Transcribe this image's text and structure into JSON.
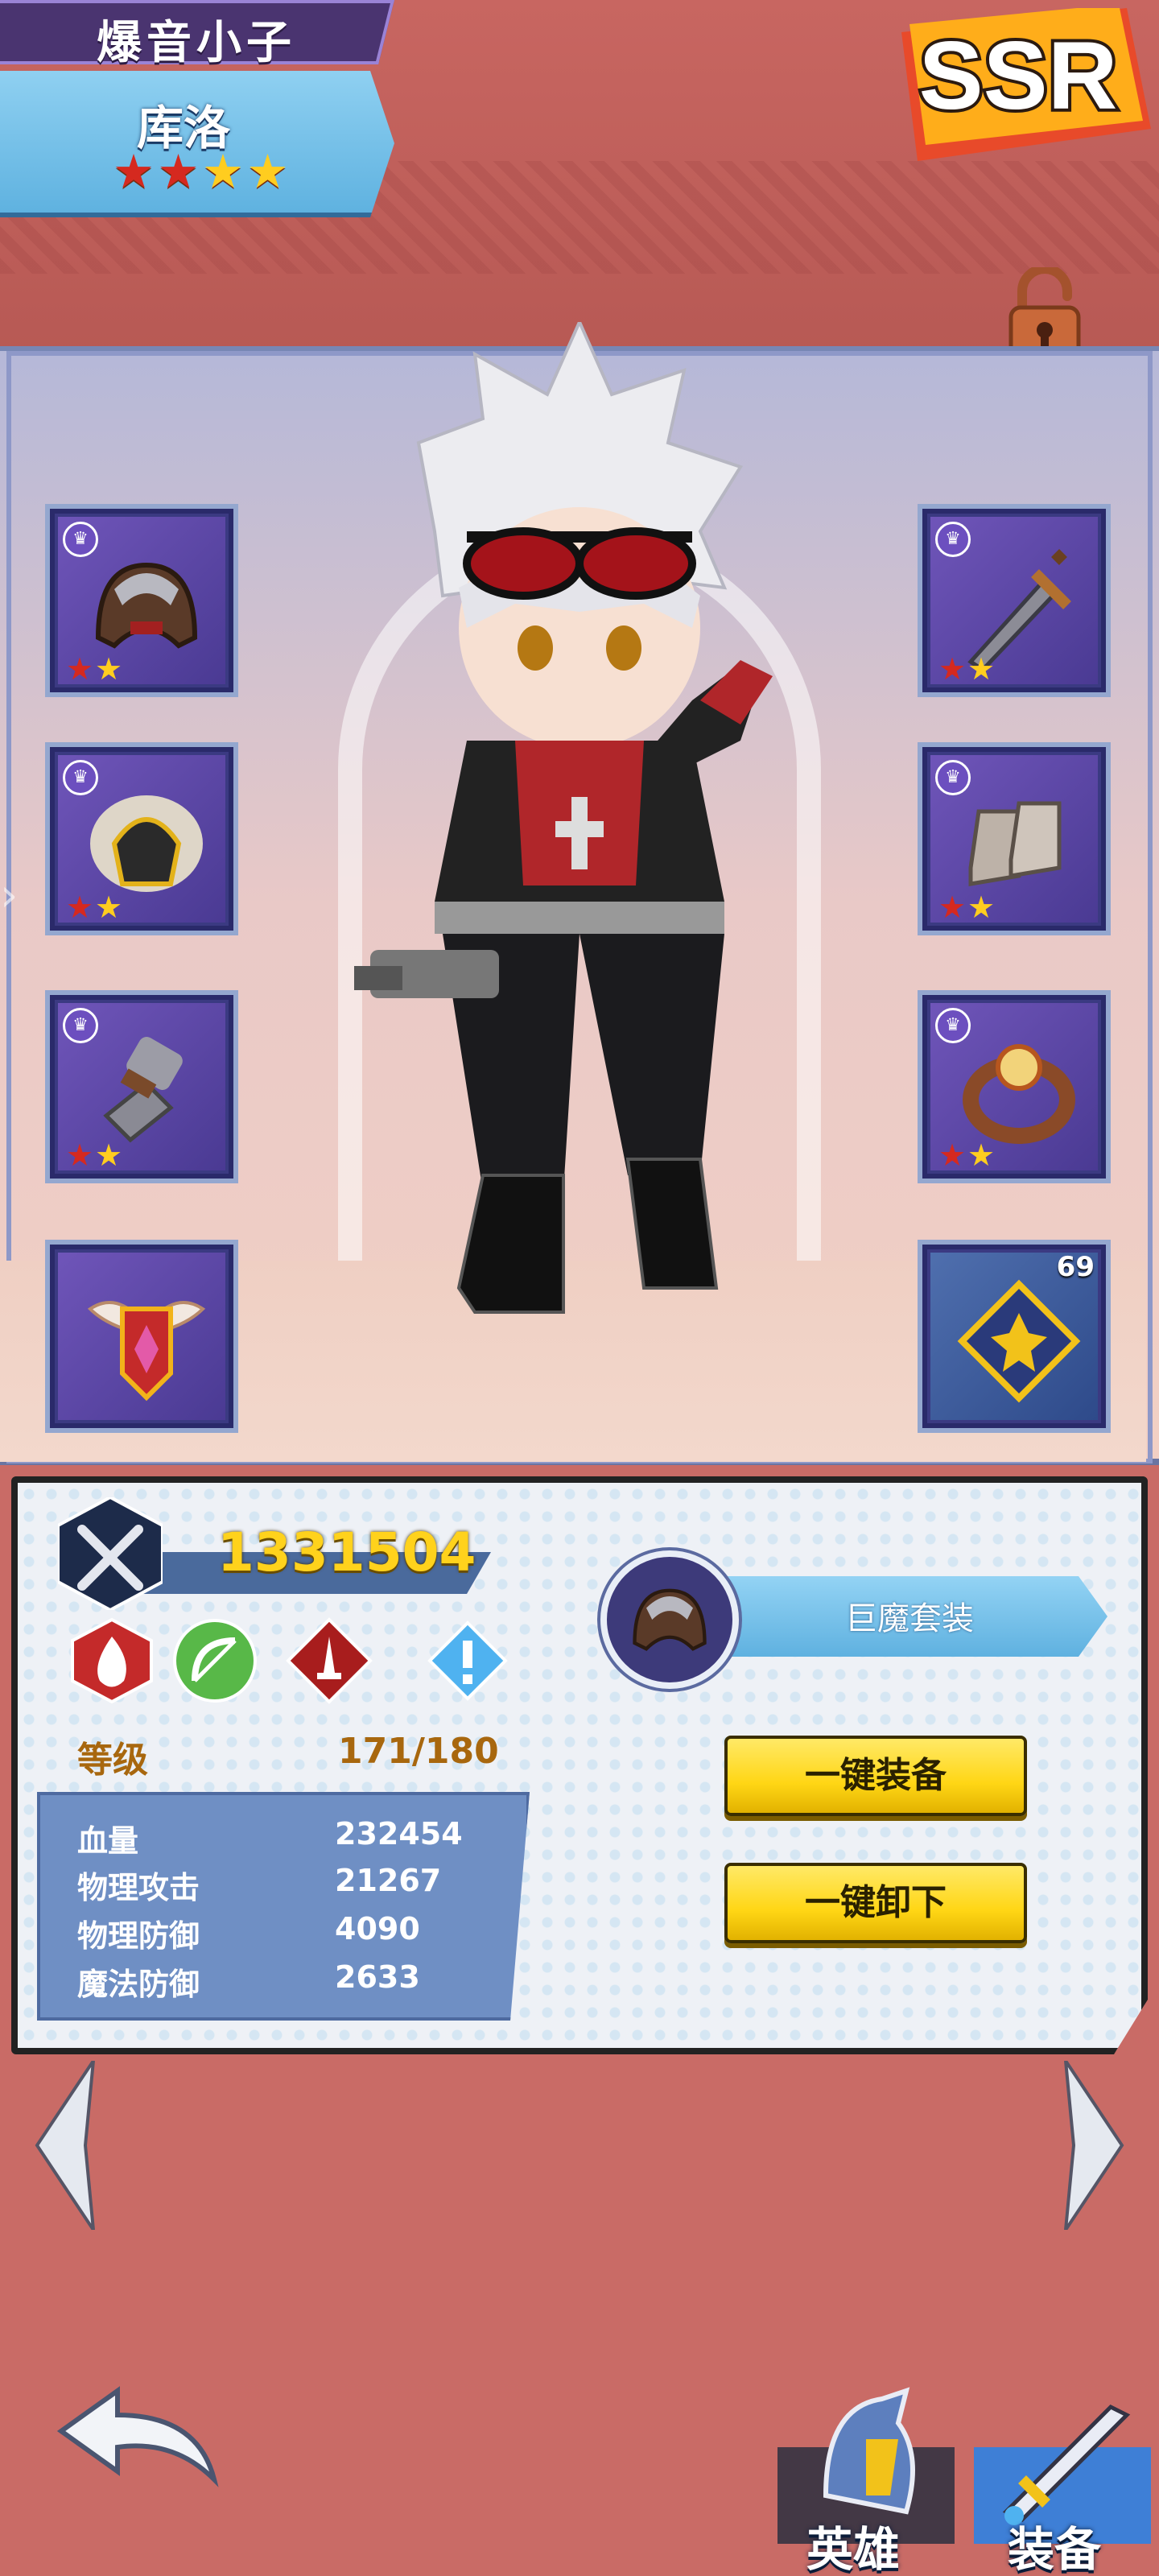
{
  "header": {
    "title": "爆音小子",
    "hero_name": "库洛",
    "stars": [
      "red",
      "red",
      "gold",
      "gold"
    ],
    "rarity": "SSR"
  },
  "equipment_slots": {
    "left": [
      {
        "name": "helmet",
        "stars": [
          "red",
          "gold"
        ],
        "icon": "helmet-icon"
      },
      {
        "name": "armor",
        "stars": [
          "red",
          "gold"
        ],
        "icon": "fur-armor-icon"
      },
      {
        "name": "gauntlet",
        "stars": [
          "red",
          "gold"
        ],
        "icon": "gauntlet-icon"
      },
      {
        "name": "wings-emblem",
        "stars": [],
        "icon": "winged-emblem-icon"
      }
    ],
    "right": [
      {
        "name": "weapon",
        "stars": [
          "red",
          "gold"
        ],
        "icon": "sword-icon"
      },
      {
        "name": "boots",
        "stars": [
          "red",
          "gold"
        ],
        "icon": "boots-icon"
      },
      {
        "name": "ring",
        "stars": [
          "red",
          "gold"
        ],
        "icon": "ring-icon"
      },
      {
        "name": "rune",
        "level": "69",
        "icon": "rune-icon"
      }
    ]
  },
  "stats": {
    "power": "1331504",
    "attribute_icons": [
      "fire-icon",
      "bow-icon",
      "dagger-icon",
      "alert-icon"
    ],
    "level_label": "等级",
    "level_value": "171/180",
    "rows": [
      {
        "label": "血量",
        "value": "232454"
      },
      {
        "label": "物理攻击",
        "value": "21267"
      },
      {
        "label": "物理防御",
        "value": "4090"
      },
      {
        "label": "魔法防御",
        "value": "2633"
      }
    ]
  },
  "set": {
    "name": "巨魔套装"
  },
  "actions": {
    "equip_all": "一键装备",
    "unequip_all": "一键卸下"
  },
  "tabs": {
    "hero": "英雄",
    "equipment": "装备"
  },
  "colors": {
    "power_gold": "#ffd21c",
    "level_brown": "#a8670e",
    "panel_blue": "#6f8fc4",
    "button_yellow": "#ffd615"
  }
}
